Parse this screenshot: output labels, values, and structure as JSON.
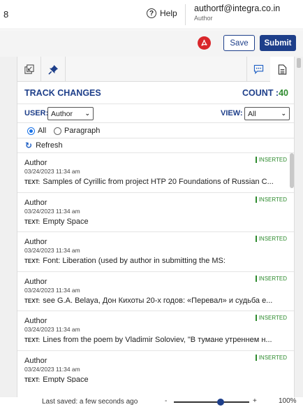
{
  "header": {
    "page_number": "8",
    "help_label": "Help",
    "user_email": "authortf@integra.co.in",
    "user_role": "Author"
  },
  "toolbar": {
    "save_label": "Save",
    "submit_label": "Submit"
  },
  "panel": {
    "title": "TRACK CHANGES",
    "count_label": "COUNT :",
    "count_value": "40",
    "user_label": "USER:",
    "user_value": "Author",
    "view_label": "VIEW:",
    "view_value": "All",
    "radio_all": "All",
    "radio_paragraph": "Paragraph",
    "refresh_label": "Refresh",
    "text_tag": "TEXT:",
    "items": [
      {
        "author": "Author",
        "date": "03/24/2023 11:34 am",
        "status": "INSERTED",
        "text": "Samples of Cyrillic from project HTP 20 Foundations of Russian C..."
      },
      {
        "author": "Author",
        "date": "03/24/2023 11:34 am",
        "status": "INSERTED",
        "text": "Empty Space"
      },
      {
        "author": "Author",
        "date": "03/24/2023 11:34 am",
        "status": "INSERTED",
        "text": "Font: Liberation (used by author in submitting the MS:"
      },
      {
        "author": "Author",
        "date": "03/24/2023 11:34 am",
        "status": "INSERTED",
        "text": "see G.A. Belaya, Дон Кихоты 20-х годов: «Перевал» и судьба е..."
      },
      {
        "author": "Author",
        "date": "03/24/2023 11:34 am",
        "status": "INSERTED",
        "text": "Lines from the poem by Vladimir Soloviev, \"В тумане утреннем н..."
      },
      {
        "author": "Author",
        "date": "03/24/2023 11:34 am",
        "status": "INSERTED",
        "text": "Empty Space"
      }
    ]
  },
  "footer": {
    "last_saved": "Last saved: a few seconds ago",
    "zoom_minus": "-",
    "zoom_plus": "+",
    "zoom_value": "100%",
    "zoom_level": 0.58
  },
  "colors": {
    "brand": "#1e3f8a",
    "inserted": "#2e8b2e",
    "pdf": "#d9262b"
  }
}
